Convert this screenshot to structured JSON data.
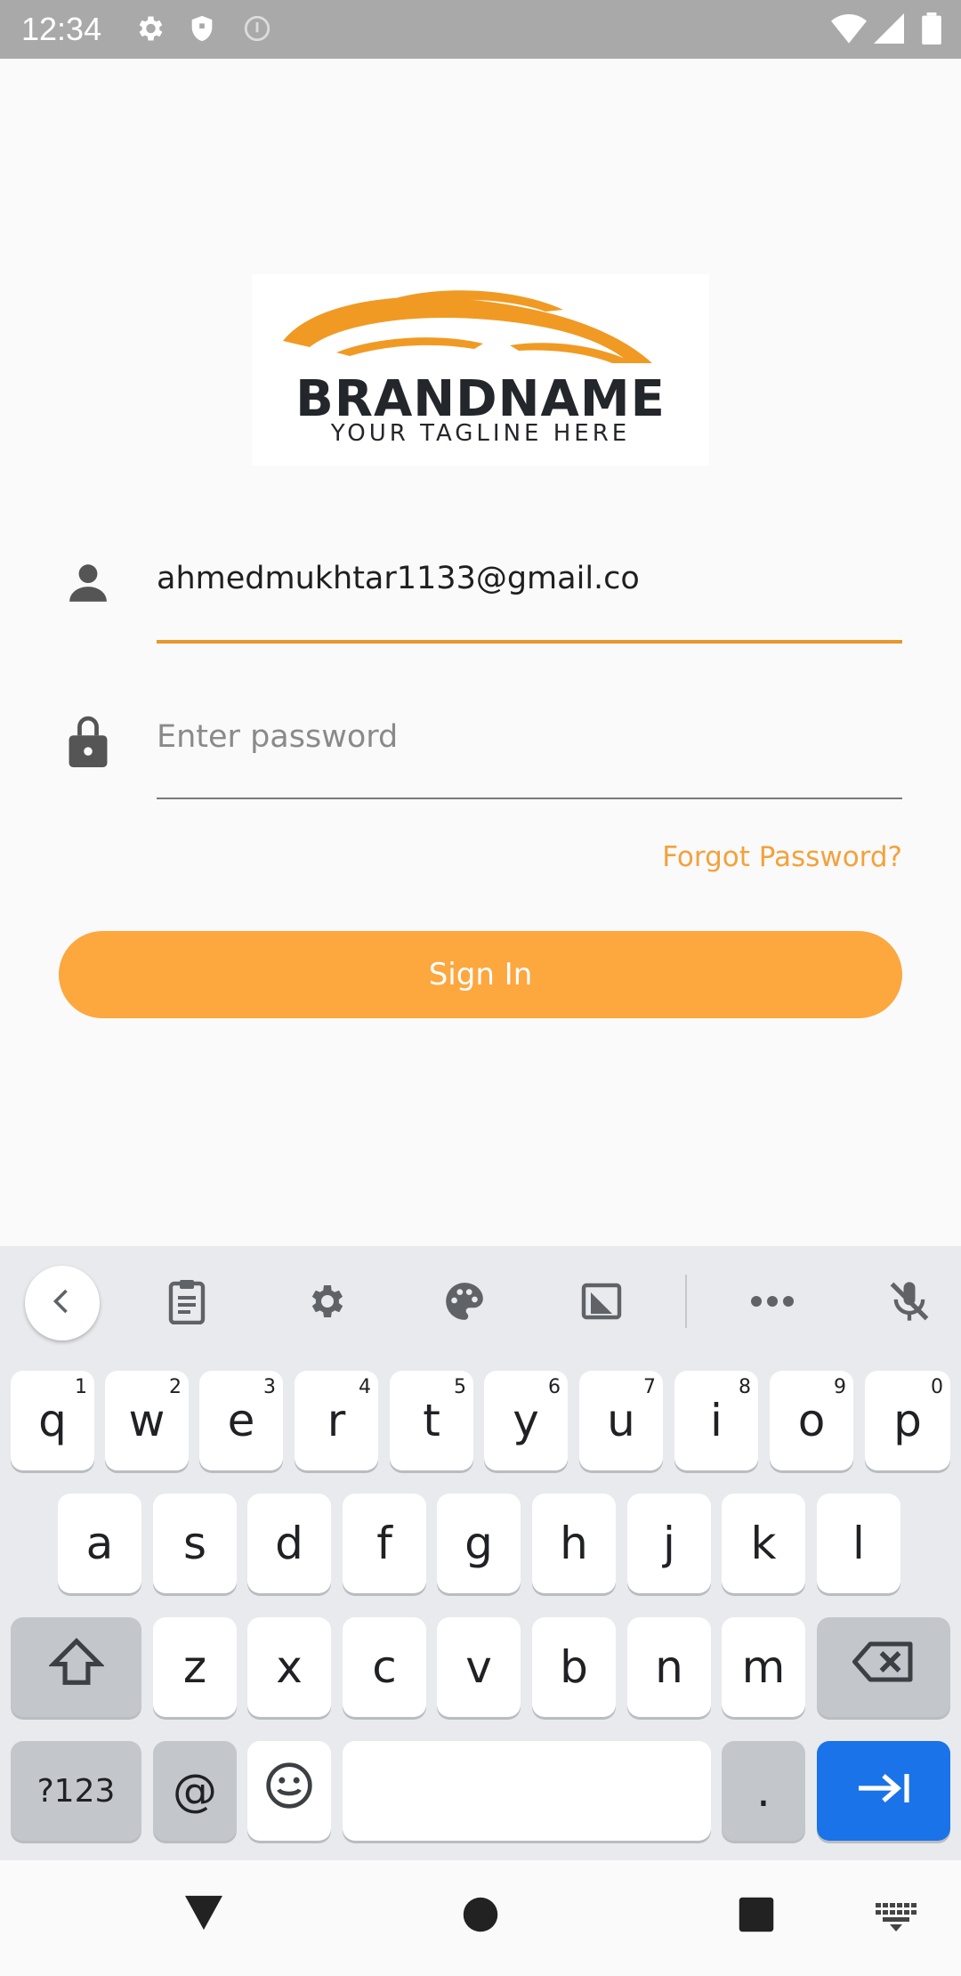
{
  "status_bar": {
    "time": "12:34"
  },
  "logo": {
    "brand": "BRANDNAME",
    "tagline": "YOUR TAGLINE HERE"
  },
  "login": {
    "email_value": "ahmedmukhtar1133@gmail.co",
    "password_placeholder": "Enter password",
    "forgot_label": "Forgot Password?",
    "signin_label": "Sign In"
  },
  "colors": {
    "accent": "#fda73f",
    "underline_active": "#e8982c",
    "enter_key": "#1a73e8"
  },
  "keyboard": {
    "toolbar_icons": [
      "chevron-left-icon",
      "clipboard-icon",
      "gear-icon",
      "palette-icon",
      "floating-keyboard-icon",
      "more-icon",
      "mic-off-icon"
    ],
    "row1": [
      {
        "key": "q",
        "sup": "1"
      },
      {
        "key": "w",
        "sup": "2"
      },
      {
        "key": "e",
        "sup": "3"
      },
      {
        "key": "r",
        "sup": "4"
      },
      {
        "key": "t",
        "sup": "5"
      },
      {
        "key": "y",
        "sup": "6"
      },
      {
        "key": "u",
        "sup": "7"
      },
      {
        "key": "i",
        "sup": "8"
      },
      {
        "key": "o",
        "sup": "9"
      },
      {
        "key": "p",
        "sup": "0"
      }
    ],
    "row2": [
      "a",
      "s",
      "d",
      "f",
      "g",
      "h",
      "j",
      "k",
      "l"
    ],
    "row3": [
      "z",
      "x",
      "c",
      "v",
      "b",
      "n",
      "m"
    ],
    "symbols_label": "?123",
    "at_label": "@",
    "period_label": "."
  }
}
